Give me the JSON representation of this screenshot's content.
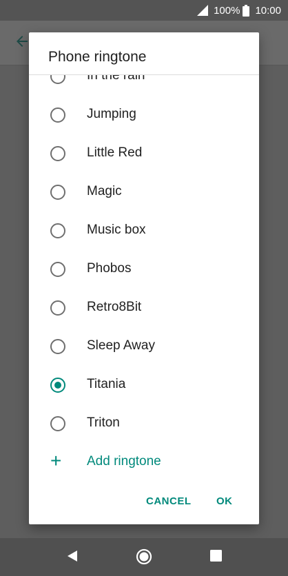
{
  "status_bar": {
    "battery_percent": "100%",
    "time": "10:00"
  },
  "dialog": {
    "title": "Phone ringtone",
    "options": [
      {
        "label": "In the rain",
        "selected": false
      },
      {
        "label": "Jumping",
        "selected": false
      },
      {
        "label": "Little Red",
        "selected": false
      },
      {
        "label": "Magic",
        "selected": false
      },
      {
        "label": "Music box",
        "selected": false
      },
      {
        "label": "Phobos",
        "selected": false
      },
      {
        "label": "Retro8Bit",
        "selected": false
      },
      {
        "label": "Sleep Away",
        "selected": false
      },
      {
        "label": "Titania",
        "selected": true
      },
      {
        "label": "Triton",
        "selected": false
      }
    ],
    "add_label": "Add ringtone",
    "cancel_label": "CANCEL",
    "ok_label": "OK"
  },
  "colors": {
    "accent": "#00897b",
    "scrim": "#5f5f5f"
  },
  "icons": {
    "back": "back-arrow-icon",
    "signal": "signal-icon",
    "battery": "battery-icon",
    "add": "plus-icon",
    "nav_back": "nav-back-icon",
    "nav_home": "nav-home-icon",
    "nav_recents": "nav-recents-icon"
  }
}
